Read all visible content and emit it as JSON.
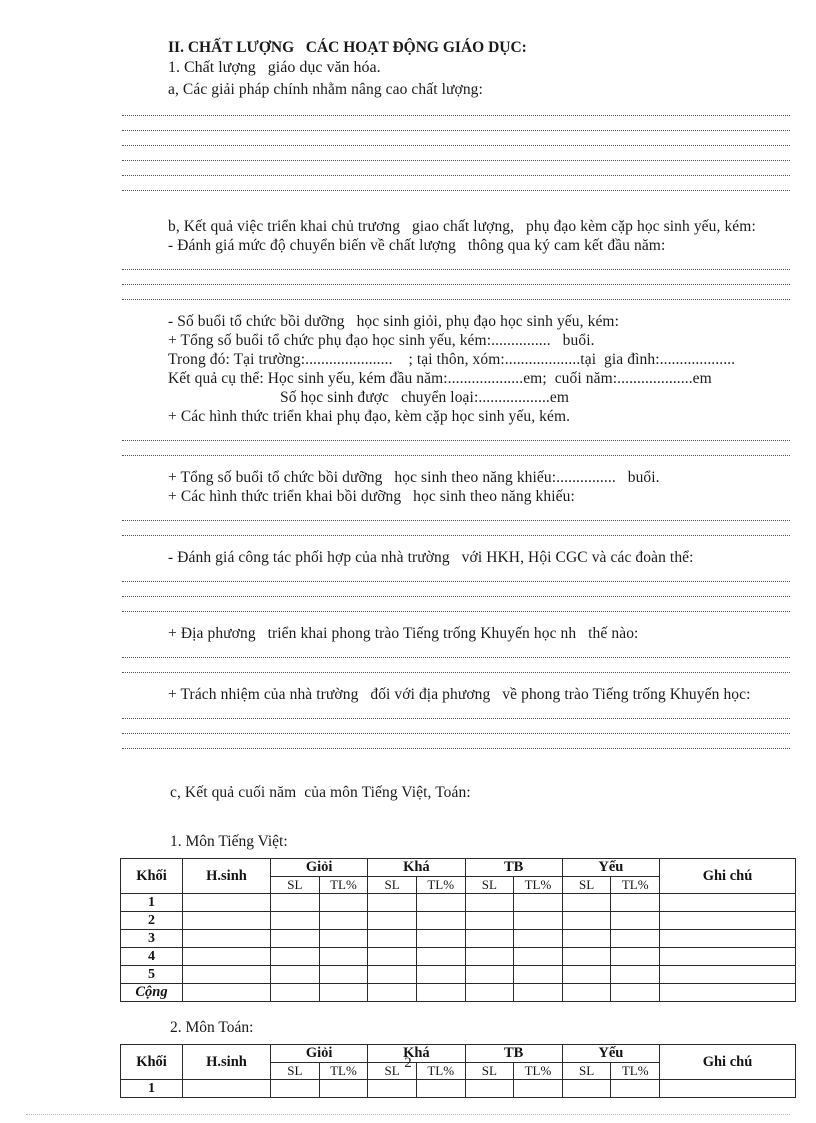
{
  "document": {
    "page_number": "2",
    "sections": [
      {
        "id": "heading_ii",
        "text": "II. CHẤT LƯỢNG   CÁC HOẠT ĐỘNG GIÁO DỤC:"
      },
      {
        "id": "heading_1",
        "text": "1. Chất lượng   giáo dục văn hóa."
      },
      {
        "id": "item_a",
        "text": "a, Các giải pháp chính nhằm nâng cao chất lượng:"
      },
      {
        "id": "item_b",
        "text": "b, Kết quả việc triển khai chủ trương   giao chất lượng,   phụ đạo kèm cặp học sinh yếu, kém:"
      },
      {
        "id": "item_b_dash1",
        "text": "- Đánh giá mức độ chuyển biến về chất lượng   thông qua ký cam kết đầu năm:"
      },
      {
        "id": "item_b_dash2",
        "text": "- Số buổi tổ chức bồi dưỡng   học sinh giỏi, phụ đạo học sinh yếu, kém:"
      },
      {
        "id": "item_b_plus1",
        "text": "+ Tổng số buổi tổ chức phụ đạo học sinh yếu, kém:...............   buổi."
      },
      {
        "id": "item_b_trongdo",
        "text": "Trong đó: Tại trường:......................    ; tại thôn, xóm:...................tại  gia đình:..................."
      },
      {
        "id": "item_b_ketqua",
        "text": "Kết quả cụ thể: Học sinh yếu, kém đầu năm:...................em;  cuối năm:...................em"
      },
      {
        "id": "item_b_sohs",
        "text": "Số học sinh được   chuyển loại:..................em"
      },
      {
        "id": "item_b_plus2",
        "text": "+ Các hình thức triển khai phụ đạo, kèm cặp học sinh yếu, kém."
      },
      {
        "id": "item_b_plus3",
        "text": "+ Tổng số buổi tổ chức bồi dưỡng   học sinh theo năng khiếu:...............   buổi."
      },
      {
        "id": "item_b_plus4",
        "text": "+ Các hình thức triển khai bồi dưỡng   học sinh theo năng khiếu:"
      },
      {
        "id": "item_b_dash3",
        "text": "- Đánh giá công tác phối hợp của nhà trường   với HKH, Hội CGC và các đoàn thể:"
      },
      {
        "id": "item_b_plus5",
        "text": "+ Địa phương   triển khai phong trào Tiếng trống Khuyến học nh   thế nào:"
      },
      {
        "id": "item_b_plus6",
        "text": "+ Trách nhiệm của nhà trường   đối với địa phương   về phong trào Tiếng trống Khuyến học:"
      },
      {
        "id": "item_c",
        "text": "c, Kết quả cuối năm  của môn Tiếng Việt, Toán:"
      }
    ]
  },
  "tables": [
    {
      "id": "table_tieng_viet",
      "caption": "1. Môn Tiếng Việt:",
      "columns": {
        "khoi": "Khối",
        "hsinh": "H.sinh",
        "ghichu": "Ghi chú"
      },
      "groups": [
        "Giỏi",
        "Khá",
        "TB",
        "Yếu"
      ],
      "subheaders": [
        "SL",
        "TL%"
      ],
      "rows": [
        "1",
        "2",
        "3",
        "4",
        "5"
      ],
      "total_label": "Cộng"
    },
    {
      "id": "table_toan",
      "caption": "2. Môn Toán:",
      "columns": {
        "khoi": "Khối",
        "hsinh": "H.sinh",
        "ghichu": "Ghi chú"
      },
      "groups": [
        "Giỏi",
        "Khá",
        "TB",
        "Yếu"
      ],
      "subheaders": [
        "SL",
        "TL%"
      ],
      "rows": [
        "1"
      ],
      "total_label": ""
    }
  ]
}
